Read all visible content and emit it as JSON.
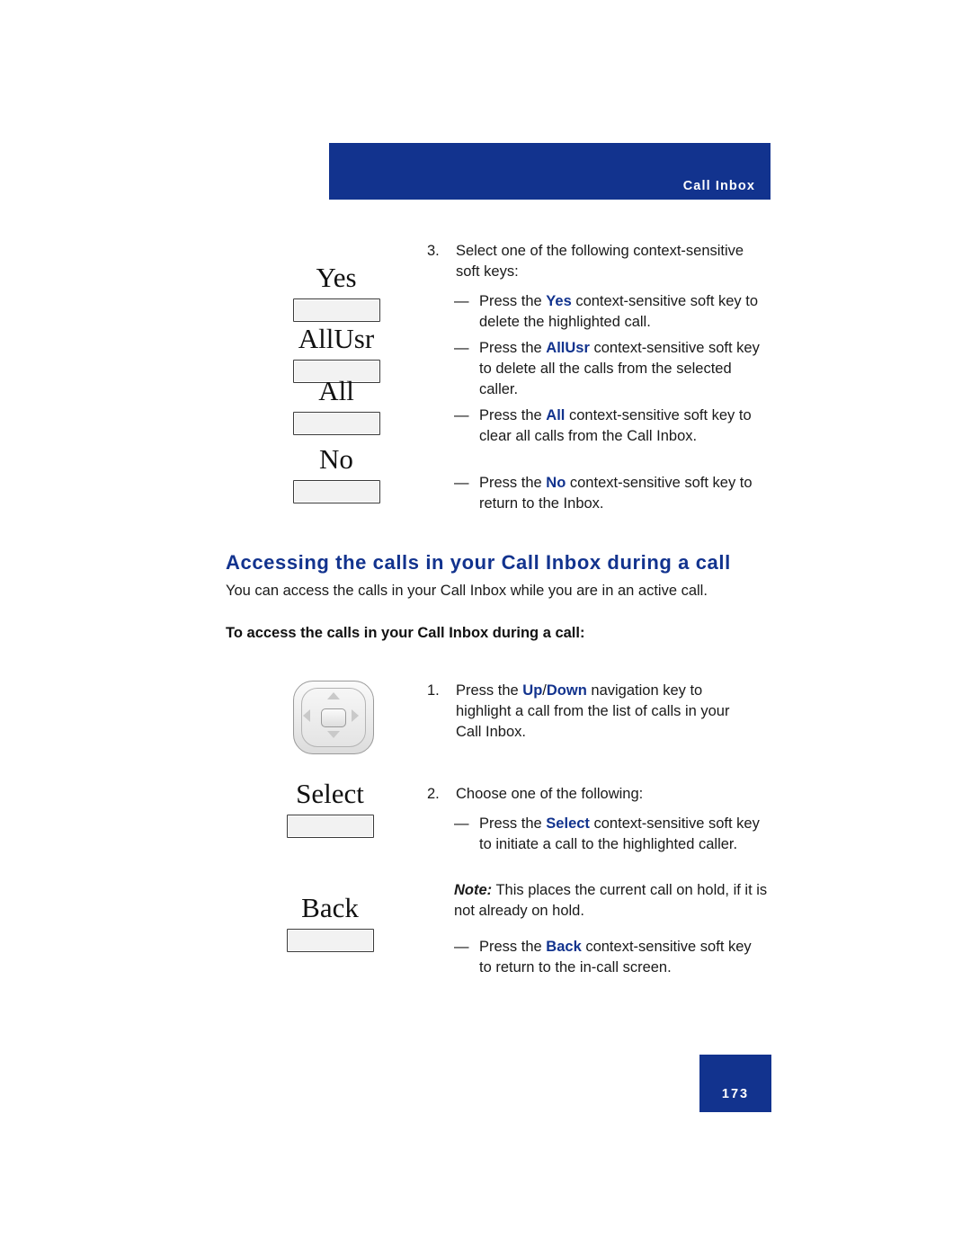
{
  "header": {
    "title": "Call Inbox"
  },
  "softkeys_top": [
    {
      "label": "Yes"
    },
    {
      "label": "AllUsr"
    },
    {
      "label": "All"
    },
    {
      "label": "No"
    }
  ],
  "softkeys_bottom": [
    {
      "label": "Select"
    },
    {
      "label": "Back"
    }
  ],
  "step3": {
    "number": "3.",
    "text": "Select one of the following context-sensitive soft keys:",
    "bullets": [
      {
        "dash": "—",
        "pre": "Press the ",
        "key": "Yes",
        "post": " context-sensitive soft key to delete the highlighted call."
      },
      {
        "dash": "—",
        "pre": "Press the ",
        "key": "AllUsr",
        "post": " context-sensitive soft key to delete all the calls from the selected caller."
      },
      {
        "dash": "—",
        "pre": "Press the ",
        "key": "All",
        "post": " context-sensitive soft key to clear all calls from the Call Inbox."
      },
      {
        "dash": "—",
        "pre": "Press the ",
        "key": "No",
        "post": " context-sensitive soft key to return to the Inbox."
      }
    ]
  },
  "section": {
    "heading": "Accessing the calls in your Call Inbox during a call",
    "intro": "You can access the calls in your Call Inbox while you are in an active call.",
    "subheading": "To access the calls in your Call Inbox during a call:"
  },
  "step1": {
    "number": "1.",
    "pre": "Press the ",
    "key1": "Up",
    "sep": "/",
    "key2": "Down",
    "post": " navigation key to highlight a call from the list of calls in your Call Inbox."
  },
  "step2": {
    "number": "2.",
    "text": "Choose one of the following:",
    "bullets": [
      {
        "dash": "—",
        "pre": "Press the ",
        "key": "Select",
        "post": " context-sensitive soft key to initiate a call to the highlighted caller."
      },
      {
        "dash": "—",
        "pre": "Press the ",
        "key": "Back",
        "post": " context-sensitive soft key to return to the in-call screen."
      }
    ],
    "note_label": "Note:",
    "note_text": " This places the current call on hold, if it is not already on hold."
  },
  "footer": {
    "page_number": "173"
  },
  "icons": {
    "nav_up": "chevron-up-icon",
    "nav_down": "chevron-down-icon",
    "nav_left": "chevron-left-icon",
    "nav_right": "chevron-right-icon"
  },
  "colors": {
    "accent": "#12338e",
    "text": "#1a1a1a"
  }
}
